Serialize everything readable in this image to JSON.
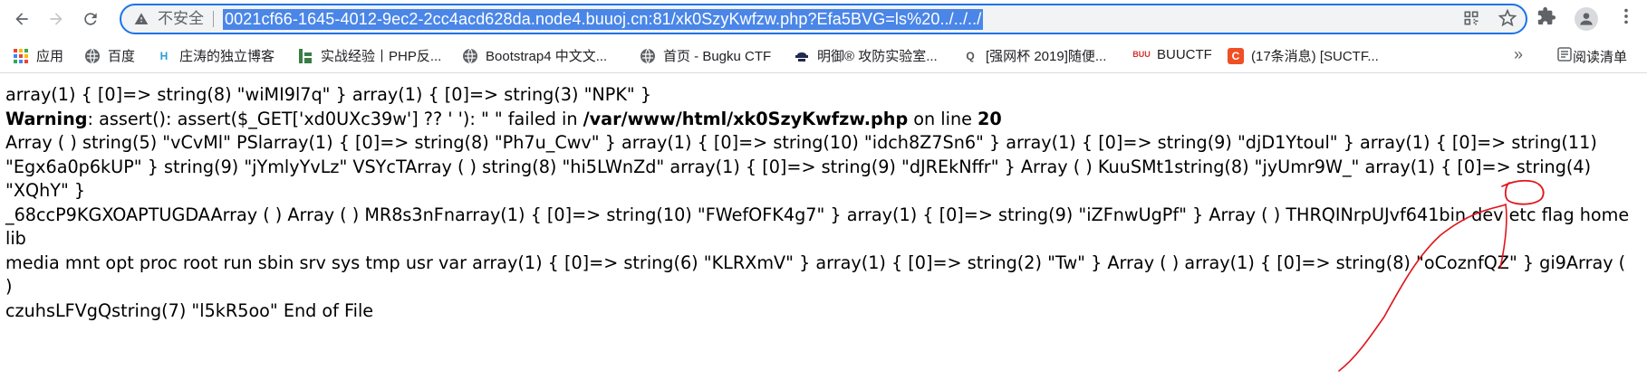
{
  "toolbar": {
    "back_icon": "arrow-left-icon",
    "forward_icon": "arrow-right-icon",
    "reload_icon": "reload-icon",
    "security_label": "不安全",
    "url": "0021cf66-1645-4012-9ec2-2cc4acd628da.node4.buuoj.cn:81/xk0SzyKwfzw.php?Efa5BVG=ls%20../../../"
  },
  "bookmarks": [
    {
      "label": "应用",
      "icon": "apps-grid-icon"
    },
    {
      "label": "百度",
      "icon": "globe-icon"
    },
    {
      "label": "庄涛的独立博客",
      "icon": "h-logo-icon"
    },
    {
      "label": "实战经验丨PHP反...",
      "icon": "green-bars-icon"
    },
    {
      "label": "Bootstrap4 中文文...",
      "icon": "globe-icon"
    },
    {
      "label": "首页 - Bugku CTF",
      "icon": "globe-icon"
    },
    {
      "label": "明御® 攻防实验室...",
      "icon": "hat-icon"
    },
    {
      "label": "[强网杯 2019]随便...",
      "icon": "q-logo-icon"
    },
    {
      "label": "BUUCTF",
      "icon": "buu-logo-icon"
    },
    {
      "label": "(17条消息) [SUCTF...",
      "icon": "csdn-c-icon"
    }
  ],
  "reading_list": "阅读清单",
  "output": {
    "line1": "array(1) { [0]=> string(8) \"wiMI9l7q\" } array(1) { [0]=> string(3) \"NPK\" }",
    "warning_label": "Warning",
    "warning_text": ": assert(): assert($_GET['xd0UXc39w'] ?? ' '): \" \" failed in ",
    "warning_file": "/var/www/html/xk0SzyKwfzw.php",
    "warning_online": " on line ",
    "warning_line": "20",
    "line3": "Array ( ) string(5) \"vCvMl\" PSlarray(1) { [0]=> string(8) \"Ph7u_Cwv\" } array(1) { [0]=> string(10) \"idch8Z7Sn6\" } array(1) { [0]=> string(9) \"djD1Ytoul\" } array(1) { [0]=> string(11)",
    "line4": "\"Egx6a0p6kUP\" } string(9) \"jYmlyYvLz\" VSYcTArray ( ) string(8) \"hi5LWnZd\" array(1) { [0]=> string(9) \"dJREkNffr\" } Array ( ) KuuSMt1string(8) \"jyUmr9W_\" array(1) { [0]=> string(4) \"XQhY\" }",
    "line5": "_68ccP9KGXOAPTUGDAArray ( ) Array ( ) MR8s3nFnarray(1) { [0]=> string(10) \"FWefOFK4g7\" } array(1) { [0]=> string(9) \"iZFnwUgPf\" } Array ( ) THRQINrpUJvf641bin dev etc flag home lib",
    "line6": "media mnt opt proc root run sbin srv sys tmp usr var array(1) { [0]=> string(6) \"KLRXmV\" } array(1) { [0]=> string(2) \"Tw\" } Array ( ) array(1) { [0]=> string(8) \"oCoznfQZ\" } gi9Array ( )",
    "line7": "czuhsLFVgQstring(7) \"l5kR5oo\" End of File"
  },
  "annotation_color": "#e0151c"
}
